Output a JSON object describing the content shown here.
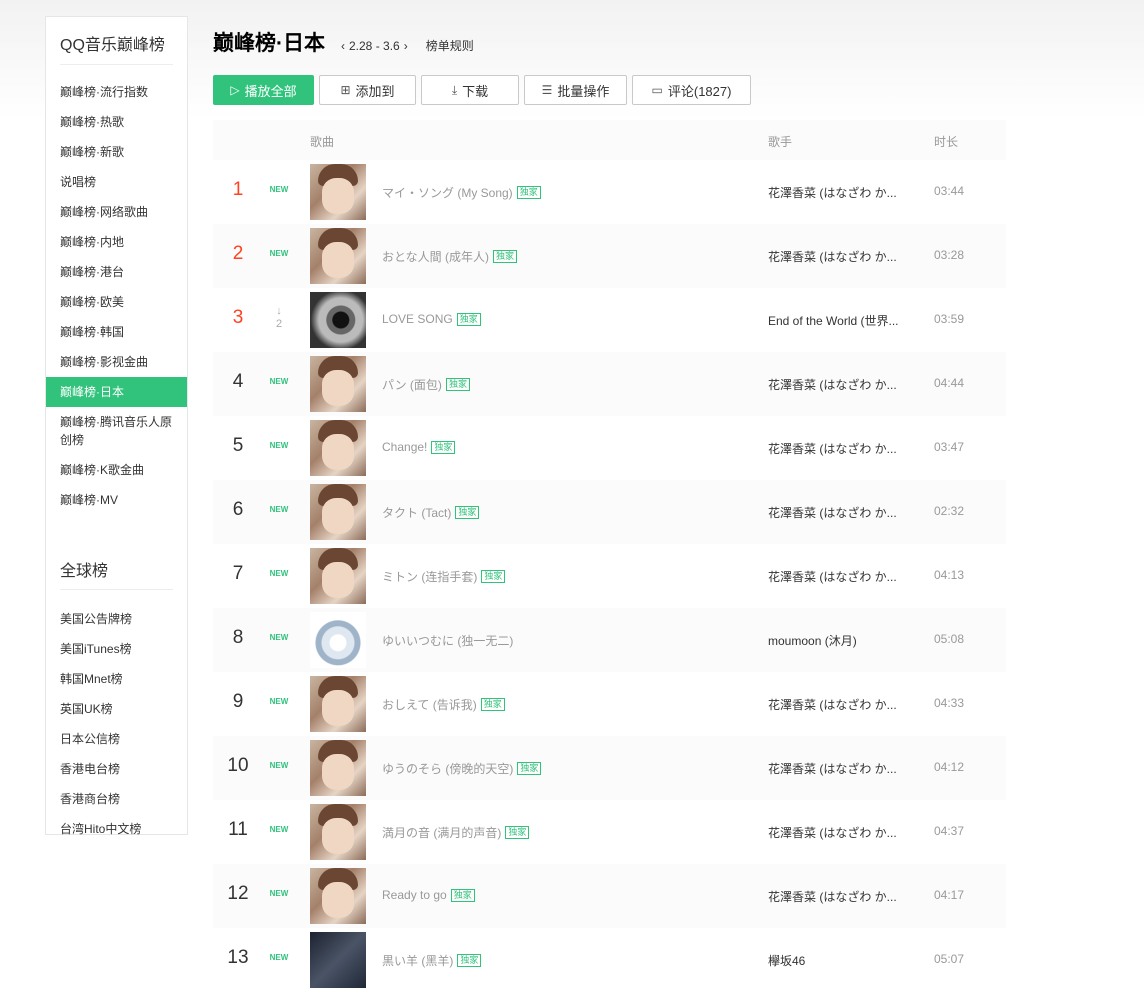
{
  "sidebar": {
    "heading": "QQ音乐巅峰榜",
    "items": [
      {
        "label": "巅峰榜·流行指数",
        "active": false
      },
      {
        "label": "巅峰榜·热歌",
        "active": false
      },
      {
        "label": "巅峰榜·新歌",
        "active": false
      },
      {
        "label": "说唱榜",
        "active": false
      },
      {
        "label": "巅峰榜·网络歌曲",
        "active": false
      },
      {
        "label": "巅峰榜·内地",
        "active": false
      },
      {
        "label": "巅峰榜·港台",
        "active": false
      },
      {
        "label": "巅峰榜·欧美",
        "active": false
      },
      {
        "label": "巅峰榜·韩国",
        "active": false
      },
      {
        "label": "巅峰榜·影视金曲",
        "active": false
      },
      {
        "label": "巅峰榜·日本",
        "active": true
      },
      {
        "label": "巅峰榜·腾讯音乐人原创榜",
        "active": false
      },
      {
        "label": "巅峰榜·K歌金曲",
        "active": false
      },
      {
        "label": "巅峰榜·MV",
        "active": false
      }
    ],
    "global_heading": "全球榜",
    "global_items": [
      {
        "label": "美国公告牌榜"
      },
      {
        "label": "美国iTunes榜"
      },
      {
        "label": "韩国Mnet榜"
      },
      {
        "label": "英国UK榜"
      },
      {
        "label": "日本公信榜"
      },
      {
        "label": "香港电台榜"
      },
      {
        "label": "香港商台榜"
      },
      {
        "label": "台湾Hito中文榜"
      }
    ]
  },
  "header": {
    "title": "巅峰榜·日本",
    "date_range": "2.28 - 3.6",
    "prev_arrow": "‹",
    "next_arrow": "›",
    "rules_link": "榜单规则"
  },
  "toolbar": {
    "play_all": "播放全部",
    "add_to": "添加到",
    "download": "下载",
    "batch": "批量操作",
    "comments": "评论(1827)",
    "play_icon": "play-icon",
    "add_icon": "plus-box-icon",
    "download_icon": "download-icon",
    "batch_icon": "edit-list-icon",
    "comment_icon": "comment-icon"
  },
  "table": {
    "headers": {
      "song": "歌曲",
      "artist": "歌手",
      "duration": "时长"
    },
    "exclusive_label": "独家",
    "new_label": "NEW",
    "rows": [
      {
        "rank": "1",
        "top": true,
        "trend": "new",
        "cover": "girl",
        "song": "マイ・ソング (My Song)",
        "exclusive": true,
        "artist": "花澤香菜 (はなざわ か...",
        "duration": "03:44"
      },
      {
        "rank": "2",
        "top": true,
        "trend": "new",
        "cover": "girl",
        "song": "おとな人間 (成年人)",
        "exclusive": true,
        "artist": "花澤香菜 (はなざわ か...",
        "duration": "03:28"
      },
      {
        "rank": "3",
        "top": true,
        "trend": "down",
        "trend_value": "2",
        "cover": "eye",
        "song": "LOVE SONG",
        "exclusive": true,
        "artist": "End of the World (世界...",
        "duration": "03:59"
      },
      {
        "rank": "4",
        "top": false,
        "trend": "new",
        "cover": "girl",
        "song": "パン (面包)",
        "exclusive": true,
        "artist": "花澤香菜 (はなざわ か...",
        "duration": "04:44"
      },
      {
        "rank": "5",
        "top": false,
        "trend": "new",
        "cover": "girl",
        "song": "Change!",
        "exclusive": true,
        "artist": "花澤香菜 (はなざわ か...",
        "duration": "03:47"
      },
      {
        "rank": "6",
        "top": false,
        "trend": "new",
        "cover": "girl",
        "song": "タクト (Tact)",
        "exclusive": true,
        "artist": "花澤香菜 (はなざわ か...",
        "duration": "02:32"
      },
      {
        "rank": "7",
        "top": false,
        "trend": "new",
        "cover": "girl",
        "song": "ミトン (连指手套)",
        "exclusive": true,
        "artist": "花澤香菜 (はなざわ か...",
        "duration": "04:13"
      },
      {
        "rank": "8",
        "top": false,
        "trend": "new",
        "cover": "gem",
        "song": "ゆいいつむに (独一无二)",
        "exclusive": false,
        "artist": "moumoon (沐月)",
        "duration": "05:08"
      },
      {
        "rank": "9",
        "top": false,
        "trend": "new",
        "cover": "girl",
        "song": "おしえて (告诉我)",
        "exclusive": true,
        "artist": "花澤香菜 (はなざわ か...",
        "duration": "04:33"
      },
      {
        "rank": "10",
        "top": false,
        "trend": "new",
        "cover": "girl",
        "song": "ゆうのそら (傍晚的天空)",
        "exclusive": true,
        "artist": "花澤香菜 (はなざわ か...",
        "duration": "04:12"
      },
      {
        "rank": "11",
        "top": false,
        "trend": "new",
        "cover": "girl",
        "song": "満月の音 (满月的声音)",
        "exclusive": true,
        "artist": "花澤香菜 (はなざわ か...",
        "duration": "04:37"
      },
      {
        "rank": "12",
        "top": false,
        "trend": "new",
        "cover": "girl",
        "song": "Ready to go",
        "exclusive": true,
        "artist": "花澤香菜 (はなざわ か...",
        "duration": "04:17"
      },
      {
        "rank": "13",
        "top": false,
        "trend": "new",
        "cover": "dark",
        "song": "黒い羊 (黑羊)",
        "exclusive": true,
        "artist": "欅坂46",
        "duration": "05:07"
      }
    ]
  },
  "colors": {
    "accent": "#31c27c",
    "top_rank": "#ff4222"
  }
}
